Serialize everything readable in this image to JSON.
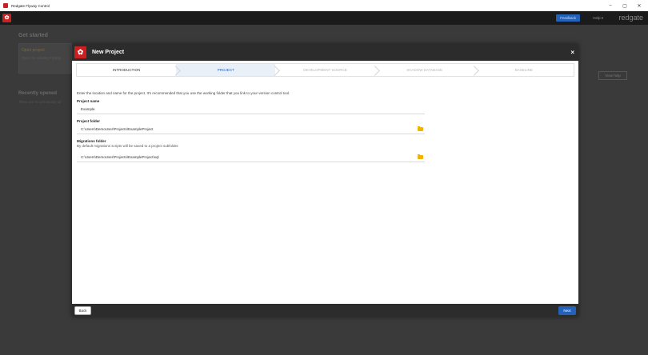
{
  "window": {
    "title": "Redgate Flyway Control",
    "controls": [
      "–",
      "▢",
      "✕"
    ]
  },
  "appbar": {
    "feedback_label": "Feedback",
    "help_label": "Help ▾",
    "brand": "redgate"
  },
  "background": {
    "get_started": "Get started",
    "open_project": "Open project",
    "open_project_desc": "Open an existing Flyway",
    "recently_opened": "Recently opened",
    "recently_opened_desc": "There are no previously op",
    "view_help": "View help"
  },
  "modal": {
    "title": "New Project",
    "close": "×",
    "steps": [
      {
        "label": "INTRODUCTION",
        "state": "done"
      },
      {
        "label": "PROJECT",
        "state": "active"
      },
      {
        "label": "DEVELOPMENT SOURCE",
        "state": "upcoming"
      },
      {
        "label": "SHADOW DATABASE",
        "state": "upcoming"
      },
      {
        "label": "BASELINE",
        "state": "upcoming"
      }
    ],
    "intro": "Enter the location and name for the project. It's recommended that you use the working folder that you link to your version control tool.",
    "project_name_label": "Project name",
    "project_name_value": "Example",
    "project_folder_label": "Project folder",
    "project_folder_value": "C:\\Users\\DemoUser\\Projects\\ExampleProject",
    "migrations_folder_label": "Migrations folder",
    "migrations_folder_hint": "By default migrations scripts will be saved to a project subfolder.",
    "migrations_folder_value": "C:\\Users\\DemoUser\\Projects\\ExampleProject\\sql",
    "back_label": "Back",
    "next_label": "Next"
  },
  "colors": {
    "accent": "#2461b8",
    "brand_red": "#cc1f1f",
    "folder_icon": "#f0b400"
  }
}
